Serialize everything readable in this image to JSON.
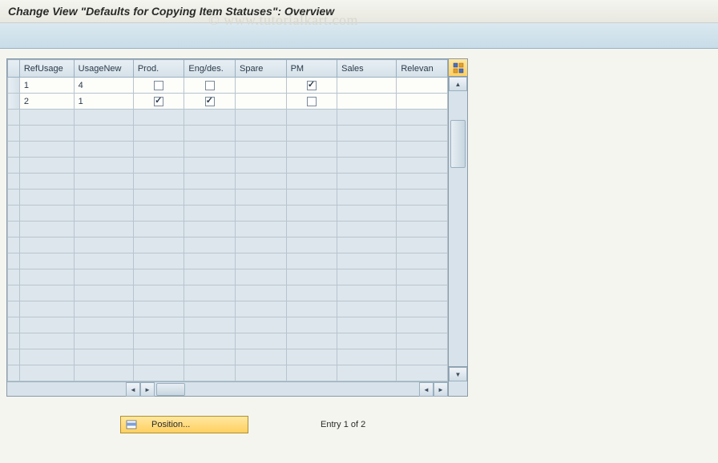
{
  "title": "Change View \"Defaults for Copying Item Statuses\": Overview",
  "watermark": "© www.tutorialkart.com",
  "columns": [
    {
      "key": "refusage",
      "label": "RefUsage"
    },
    {
      "key": "usagenew",
      "label": "UsageNew"
    },
    {
      "key": "prod",
      "label": "Prod."
    },
    {
      "key": "engdes",
      "label": "Eng/des."
    },
    {
      "key": "spare",
      "label": "Spare"
    },
    {
      "key": "pm",
      "label": "PM"
    },
    {
      "key": "sales",
      "label": "Sales"
    },
    {
      "key": "relevan",
      "label": "Relevan"
    }
  ],
  "rows": [
    {
      "refusage": "1",
      "usagenew": "4",
      "prod": false,
      "engdes": false,
      "spare": null,
      "pm": true,
      "sales": "",
      "relevan": ""
    },
    {
      "refusage": "2",
      "usagenew": "1",
      "prod": true,
      "engdes": true,
      "spare": null,
      "pm": false,
      "sales": "",
      "relevan": ""
    }
  ],
  "empty_rows": 17,
  "position_button": "Position...",
  "entry_status": "Entry 1 of 2",
  "icons": {
    "settings": "table-settings-icon",
    "position": "position-icon"
  }
}
